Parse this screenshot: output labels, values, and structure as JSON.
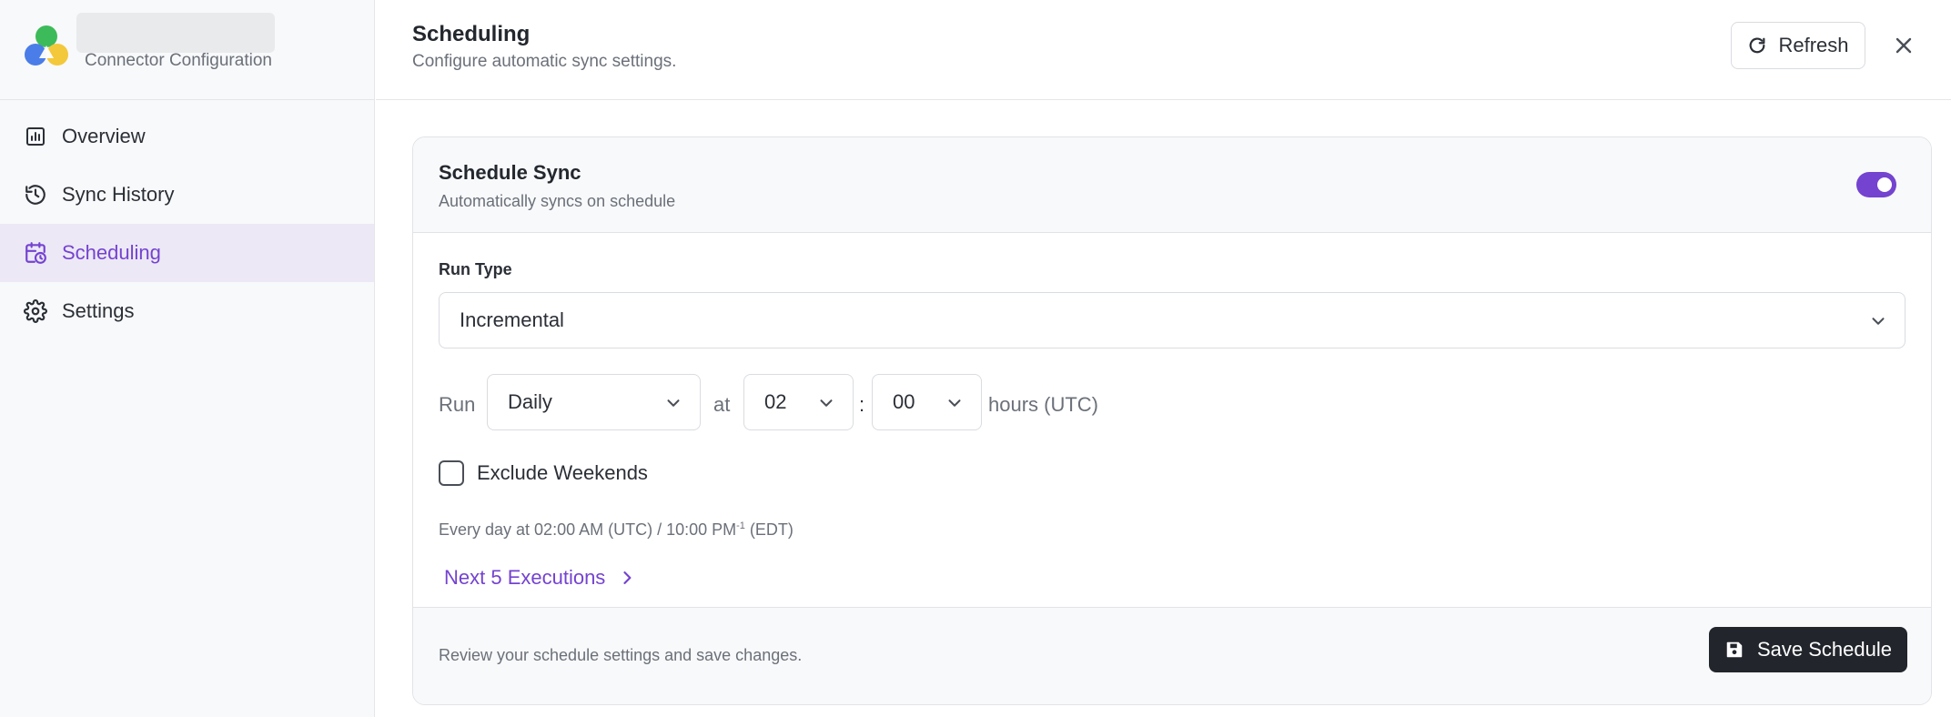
{
  "sidebar": {
    "brand_subtitle": "Connector Configuration",
    "items": [
      {
        "label": "Overview",
        "icon": "chart-bar-icon",
        "active": false
      },
      {
        "label": "Sync History",
        "icon": "history-icon",
        "active": false
      },
      {
        "label": "Scheduling",
        "icon": "calendar-clock-icon",
        "active": true
      },
      {
        "label": "Settings",
        "icon": "gear-icon",
        "active": false
      }
    ]
  },
  "header": {
    "title": "Scheduling",
    "subtitle": "Configure automatic sync settings.",
    "refresh_label": "Refresh"
  },
  "schedule": {
    "title": "Schedule Sync",
    "subtitle": "Automatically syncs on schedule",
    "enabled": true,
    "run_type_label": "Run Type",
    "run_type_value": "Incremental",
    "run_prefix": "Run",
    "frequency_value": "Daily",
    "at_label": "at",
    "hour_value": "02",
    "colon": ":",
    "minute_value": "00",
    "hours_suffix": "hours (UTC)",
    "exclude_weekends_label": "Exclude Weekends",
    "exclude_weekends_checked": false,
    "summary_text": "Every day at 02:00 AM (UTC) / 10:00 PM",
    "summary_sup": "-1",
    "summary_tz": " (EDT)",
    "next_executions_label": "Next 5 Executions"
  },
  "footer": {
    "text": "Review your schedule settings and save changes.",
    "save_label": "Save Schedule"
  },
  "colors": {
    "accent": "#7443d0",
    "active_bg": "#ece8f6",
    "dark_button": "#22262c"
  }
}
